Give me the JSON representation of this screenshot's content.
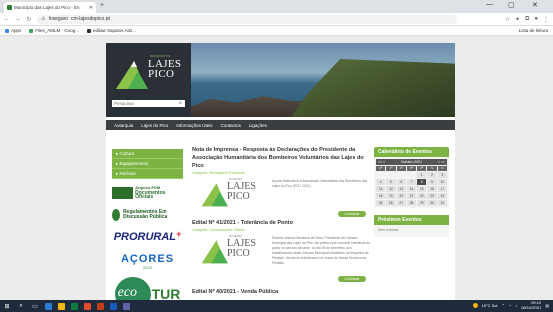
{
  "browser": {
    "tab_title": "Município das Lajes do Pico - En",
    "url": "cm-lajesdopico.pt",
    "security_label": "Inseguro",
    "bookmarks": [
      "Apps",
      "Files_AMLM - Goog...",
      "edilaw Sapatos Adv..."
    ],
    "reading_list": "Lista de leitura"
  },
  "site": {
    "logo_small": "MUNICÍPIO",
    "logo_line1": "LAJES",
    "logo_line2": "PICO",
    "search_placeholder": "Pesquisar",
    "nav": [
      "Autarquia",
      "Lajes do Pico",
      "Informações Úteis",
      "Contactos",
      "Ligações"
    ],
    "side_menu": [
      "Cultura",
      "Equipamentos",
      "Notícias"
    ],
    "side_banners": {
      "docs": "Documentos Oficiais",
      "docs_top": "Arquivo PDM",
      "regulamentos": "Regulamentos Em Discussão Pública",
      "prorural": "PRORURAL",
      "acores": "AÇORES",
      "acores_sub": "2020",
      "eco": "eco",
      "tur": "TUR"
    }
  },
  "articles": [
    {
      "title": "Nota de Imprensa - Resposta às Declarações do Presidente da Associação Humanitária dos Bombeiros Voluntários das Lajes do Pico",
      "category": "Categoria: Mensagens Presidente",
      "excerpt": "Apoios financeiros à Associação Humanitária dos Bombeiros das Lajes do Pico (2017-2021)",
      "button": "Continuar"
    },
    {
      "title": "Edital Nº 41/2021 - Tolerância de Ponto",
      "category": "Categoria: Comunicações Oficiais",
      "excerpt": "Roberto Manuel Medeiros da Silva, Presidente da Câmara Municipal das Lajes do Pico, faz público que concede tolerância de ponto no período da tarde, do dia 08 de setembro, aos trabalhadores desta Câmara Municipal residentes na freguesia da Piedade, devido às festividades em honra de Nossa Senhora da Piedade.",
      "button": "Continuar"
    },
    {
      "title": "Edital Nº 40/2021 - Venda Pública"
    }
  ],
  "calendar": {
    "title": "Calendário de Eventos",
    "month": "Outubro 2021",
    "prev": "<< <",
    "next": "> >>",
    "weekdays": [
      "2ª",
      "3ª",
      "4ª",
      "5ª",
      "6ª",
      "S",
      "D"
    ],
    "days": [
      "",
      "",
      "",
      "",
      "1",
      "2",
      "3",
      "4",
      "5",
      "6",
      "7",
      "8",
      "9",
      "10",
      "11",
      "12",
      "13",
      "14",
      "15",
      "16",
      "17",
      "18",
      "19",
      "20",
      "21",
      "22",
      "23",
      "24",
      "25",
      "26",
      "27",
      "28",
      "29",
      "30",
      "31"
    ],
    "today": "8"
  },
  "upcoming": {
    "title": "Próximos Eventos",
    "empty": "Sem eventos"
  },
  "taskbar": {
    "weather": "15°C  Sol",
    "time": "09:12",
    "date": "08/10/2021"
  },
  "colors": {
    "accent": "#7cb342",
    "nav_bg": "#3a3d41",
    "taskbar": "#1f2a3c"
  }
}
